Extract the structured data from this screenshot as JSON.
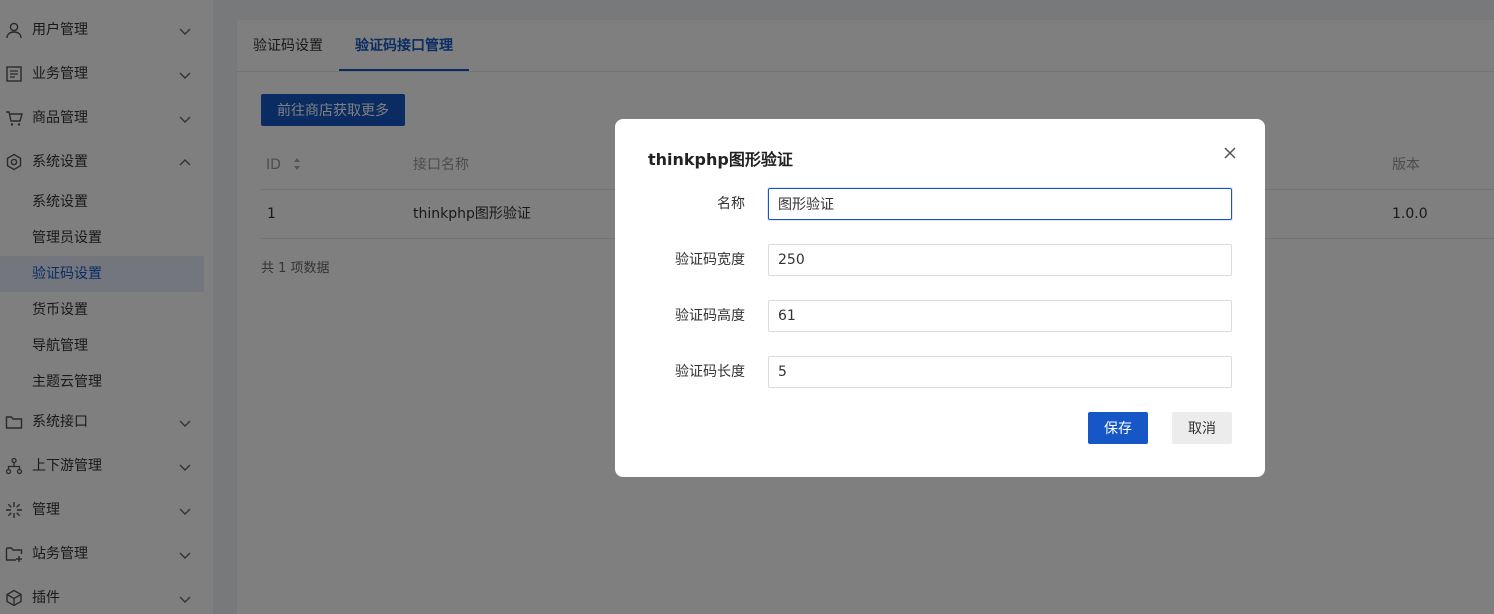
{
  "sidebar": {
    "menu": [
      {
        "label": "用户管理",
        "icon": "user-icon",
        "expanded": false
      },
      {
        "label": "业务管理",
        "icon": "document-icon",
        "expanded": false
      },
      {
        "label": "商品管理",
        "icon": "cart-icon",
        "expanded": false
      },
      {
        "label": "系统设置",
        "icon": "gear-icon",
        "expanded": true
      },
      {
        "label": "系统接口",
        "icon": "folder-icon",
        "expanded": false
      },
      {
        "label": "上下游管理",
        "icon": "hierarchy-icon",
        "expanded": false
      },
      {
        "label": "管理",
        "icon": "sparkle-icon",
        "expanded": false
      },
      {
        "label": "站务管理",
        "icon": "add-folder-icon",
        "expanded": false
      },
      {
        "label": "插件",
        "icon": "plugin-icon",
        "expanded": false
      }
    ],
    "submenu": [
      "系统设置",
      "管理员设置",
      "验证码设置",
      "货币设置",
      "导航管理",
      "主题云管理"
    ],
    "active_submenu": "验证码设置"
  },
  "tabs": [
    {
      "label": "验证码设置",
      "active": false
    },
    {
      "label": "验证码接口管理",
      "active": true
    }
  ],
  "store_button": "前往商店获取更多",
  "table": {
    "headers": {
      "id": "ID",
      "name": "接口名称",
      "version": "版本"
    },
    "rows": [
      {
        "id": "1",
        "name": "thinkphp图形验证",
        "version": "1.0.0"
      }
    ],
    "total": "共 1 项数据"
  },
  "modal": {
    "title": "thinkphp图形验证",
    "fields": [
      {
        "label": "名称",
        "value": "图形验证"
      },
      {
        "label": "验证码宽度",
        "value": "250"
      },
      {
        "label": "验证码高度",
        "value": "61"
      },
      {
        "label": "验证码长度",
        "value": "5"
      }
    ],
    "save": "保存",
    "cancel": "取消"
  },
  "colors": {
    "primary": "#1656c7",
    "mask": "rgba(0,0,0,0.5)"
  }
}
